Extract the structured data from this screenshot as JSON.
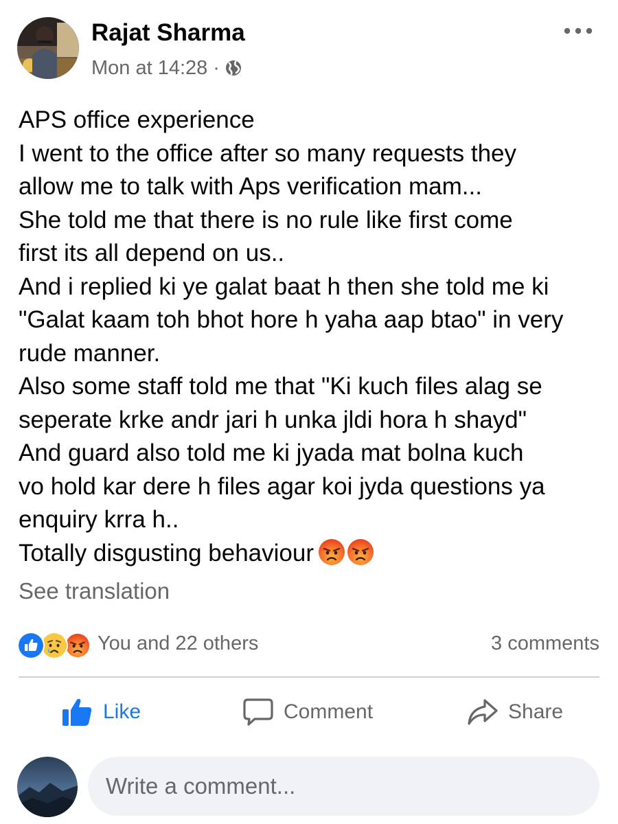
{
  "post": {
    "author": "Rajat Sharma",
    "timestamp": "Mon at 14:28",
    "meta_separator": "·",
    "audience_icon": "globe-icon",
    "more_icon": "more-options-icon",
    "body_lines": [
      "APS office experience",
      "I went to the office after so many requests they",
      "allow me to talk with  Aps verification mam...",
      "She told me that there is no rule like first come",
      "first its all depend on us..",
      "And i replied ki ye galat baat h then she told me ki",
      "\"Galat kaam toh bhot hore h yaha aap btao\" in very",
      "rude manner.",
      "Also some staff told me that \"Ki kuch files alag se",
      "seperate krke andr jari h unka jldi hora h shayd\"",
      "And guard also told me ki jyada mat bolna kuch",
      "vo hold kar dere h files agar koi jyda questions ya",
      "enquiry krra h..",
      "Totally disgusting behaviour"
    ],
    "trailing_emojis": [
      "angry-face-emoji",
      "angry-face-emoji"
    ],
    "see_translation": "See translation"
  },
  "engagement": {
    "reaction_icons": [
      "like-reaction-icon",
      "sad-reaction-icon",
      "angry-reaction-icon"
    ],
    "reactors": "You and 22 others",
    "comment_count": "3 comments"
  },
  "actions": {
    "like": "Like",
    "comment": "Comment",
    "share": "Share"
  },
  "composer": {
    "placeholder": "Write a comment..."
  },
  "colors": {
    "text_primary": "#050505",
    "text_secondary": "#65676b",
    "accent_blue": "#1877f2",
    "divider": "#ced0d4",
    "input_background": "#f0f2f5",
    "angry_emoji": "#f15223"
  }
}
